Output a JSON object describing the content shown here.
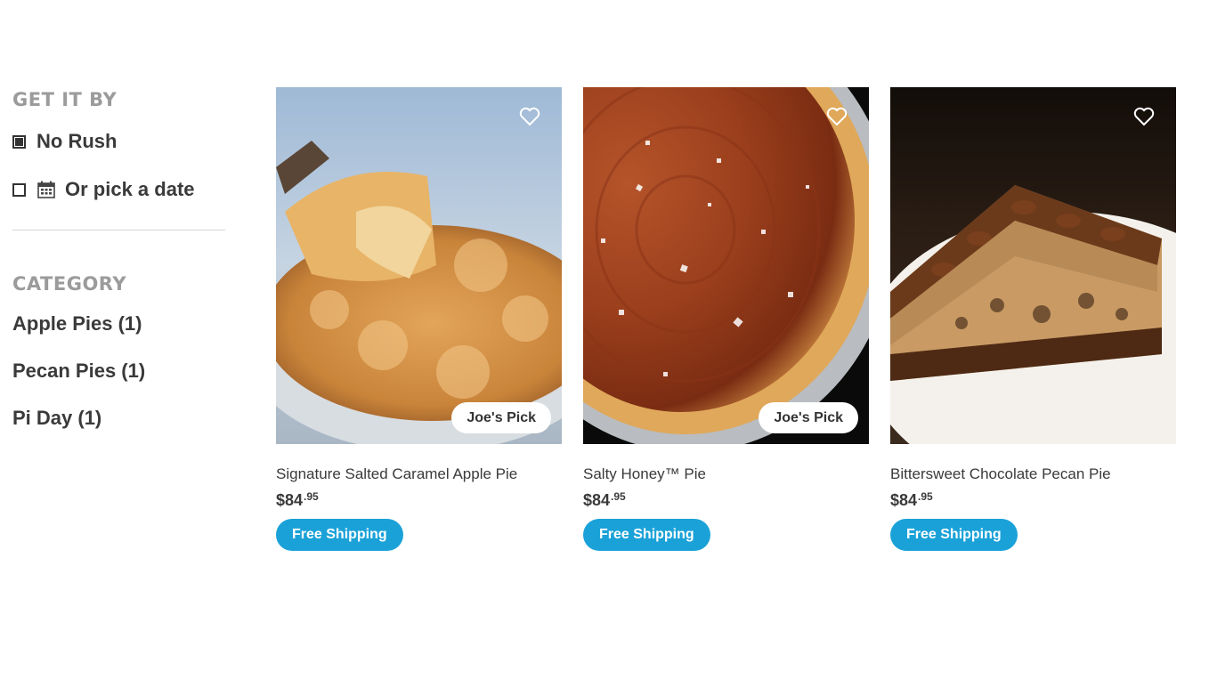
{
  "filters": {
    "get_it_by": {
      "heading": "GET IT BY",
      "no_rush": "No Rush",
      "pick_date": "Or pick a date"
    },
    "category": {
      "heading": "CATEGORY",
      "items": [
        "Apple Pies (1)",
        "Pecan Pies (1)",
        "Pi Day (1)"
      ]
    }
  },
  "products": [
    {
      "title": "Signature Salted Caramel Apple Pie",
      "price_main": "$84",
      "price_cents": ".95",
      "badge": "Joe's Pick",
      "shipping": "Free Shipping"
    },
    {
      "title": "Salty Honey™ Pie",
      "price_main": "$84",
      "price_cents": ".95",
      "badge": "Joe's Pick",
      "shipping": "Free Shipping"
    },
    {
      "title": "Bittersweet Chocolate Pecan Pie",
      "price_main": "$84",
      "price_cents": ".95",
      "shipping": "Free Shipping"
    }
  ],
  "colors": {
    "accent": "#1aa2d8",
    "heading_gray": "#9b9b9b",
    "text": "#3a3a3a"
  }
}
